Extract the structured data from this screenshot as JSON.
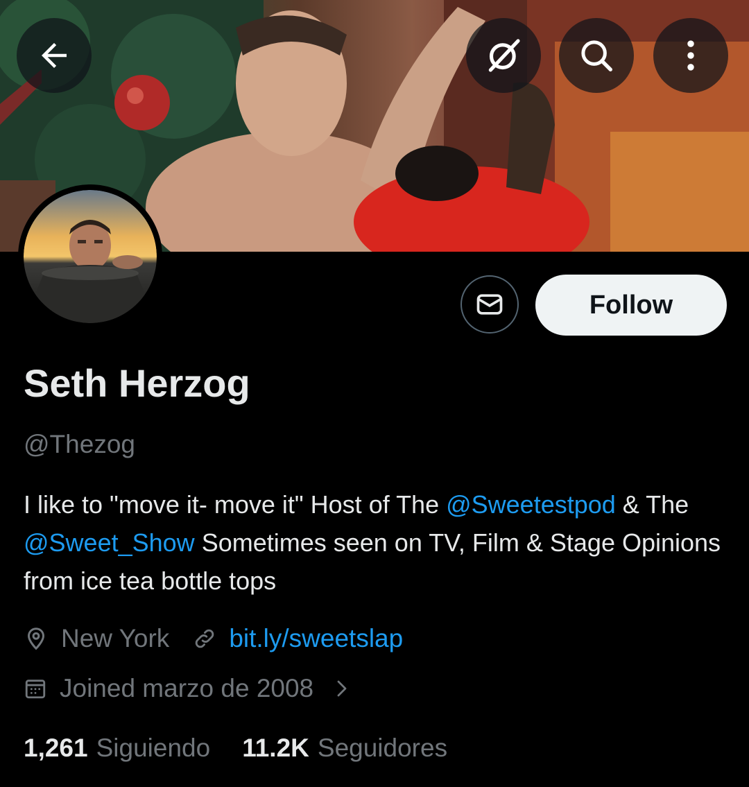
{
  "header": {
    "back_icon": "arrow-left-icon",
    "grok_icon": "grok-icon",
    "search_icon": "search-icon",
    "more_icon": "more-vertical-icon"
  },
  "profile": {
    "name": "Seth Herzog",
    "handle": "@Thezog",
    "bio": {
      "part1": "I like to \"move it- move it\" Host of The ",
      "mention1": "@Sweetestpod",
      "part2": " & The ",
      "mention2": "@Sweet_Show",
      "part3": " Sometimes seen on TV, Film & Stage Opinions from ice tea bottle tops"
    },
    "location": "New York",
    "website": "bit.ly/sweetslap",
    "joined": "Joined marzo de 2008"
  },
  "actions": {
    "follow_label": "Follow",
    "message_icon": "mail-icon"
  },
  "stats": {
    "following_count": "1,261",
    "following_label": "Siguiendo",
    "followers_count": "11.2K",
    "followers_label": "Seguidores"
  },
  "colors": {
    "background": "#000000",
    "text": "#e7e9ea",
    "secondary": "#71767b",
    "accent": "#1d9bf0",
    "follow_bg": "#eff3f4"
  }
}
